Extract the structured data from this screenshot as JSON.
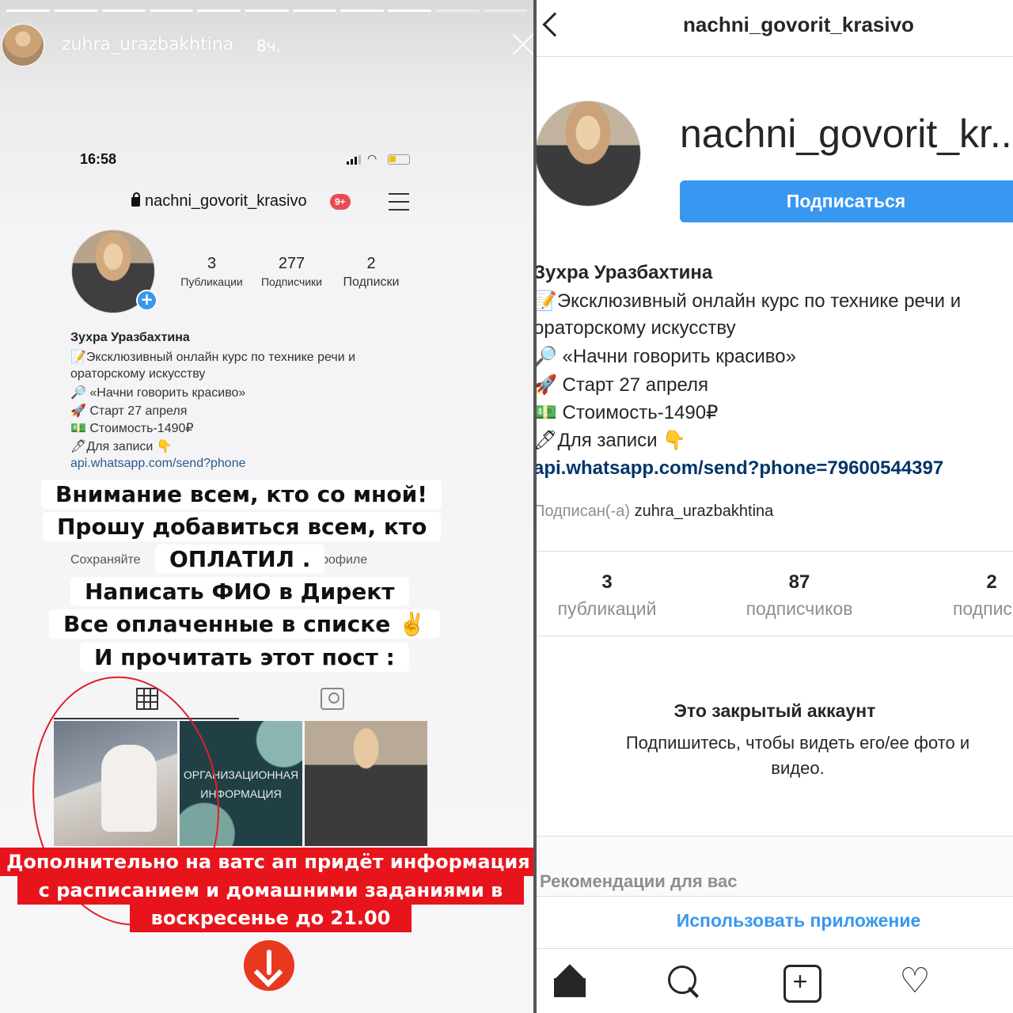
{
  "story": {
    "username": "zuhra_urazbakhtina",
    "time": "8ч.",
    "progress_segments": 11,
    "progress_completed": 9
  },
  "screenshot": {
    "status_time": "16:58",
    "username": "nachni_govorit_krasivo",
    "notification_badge": "9+",
    "stats": [
      {
        "count": "3",
        "label": "Публикации"
      },
      {
        "count": "277",
        "label": "Подписчики"
      },
      {
        "count": "2",
        "label": "Подписки"
      }
    ],
    "bio": {
      "name": "Зухра  Уразбахтина",
      "line1": "📝Эксклюзивный онлайн курс по технике речи и",
      "line2": "ораторскому искусству",
      "line3": "🔎 «Начни говорить красиво»",
      "line4": "🚀 Старт 27 апреля",
      "line5": "💵 Стоимость-1490₽",
      "line6": "🖊Для записи 👇",
      "link": "api.whatsapp.com/send?phone"
    },
    "save_fragment": "Сохраняйте",
    "profile_fragment": "рофиле",
    "tile2_text_1": "ОРГАНИЗАЦИОННАЯ",
    "tile2_text_2": "ИНФОРМАЦИЯ"
  },
  "overlay_text": [
    "Внимание всем, кто со мной!",
    "Прошу добавиться всем, кто",
    "ОПЛАТИЛ .",
    "Написать  ФИО в Директ",
    "Все оплаченные в списке ✌️",
    "И прочитать этот пост :"
  ],
  "red_text": [
    "Дополнительно на  ватс ап придёт информация",
    "с расписанием и домашними заданиями в",
    "воскресенье до 21.00"
  ],
  "profile": {
    "top_title": "nachni_govorit_krasivo",
    "display_username": "nachni_govorit_kr...",
    "follow_label": "Подписаться",
    "name": "Зухра Уразбахтина",
    "bio": [
      "📝Эксклюзивный онлайн курс по технике речи и",
      "ораторскому искусству",
      "🔎 «Начни говорить красиво»",
      "🚀 Старт 27 апреля",
      "💵 Стоимость-1490₽",
      "🖊Для записи 👇"
    ],
    "link": "api.whatsapp.com/send?phone=79600544397",
    "followed_by_prefix": "Подписан(-а)",
    "followed_by_user": "zuhra_urazbakhtina",
    "stats": [
      {
        "count": "3",
        "label": "публикаций"
      },
      {
        "count": "87",
        "label": "подписчиков"
      },
      {
        "count": "2",
        "label": "подписок"
      }
    ],
    "private_title": "Это закрытый аккаунт",
    "private_text": "Подпишитесь, чтобы видеть его/ее фото и видео.",
    "recommendations": "Рекомендации для вас",
    "use_app": "Использовать приложение"
  },
  "nav_icons": [
    "home-icon",
    "search-icon",
    "add-icon",
    "heart-icon"
  ],
  "colors": {
    "accent_blue": "#3897f0",
    "story_red": "#e8141c",
    "link_blue": "#003569"
  }
}
